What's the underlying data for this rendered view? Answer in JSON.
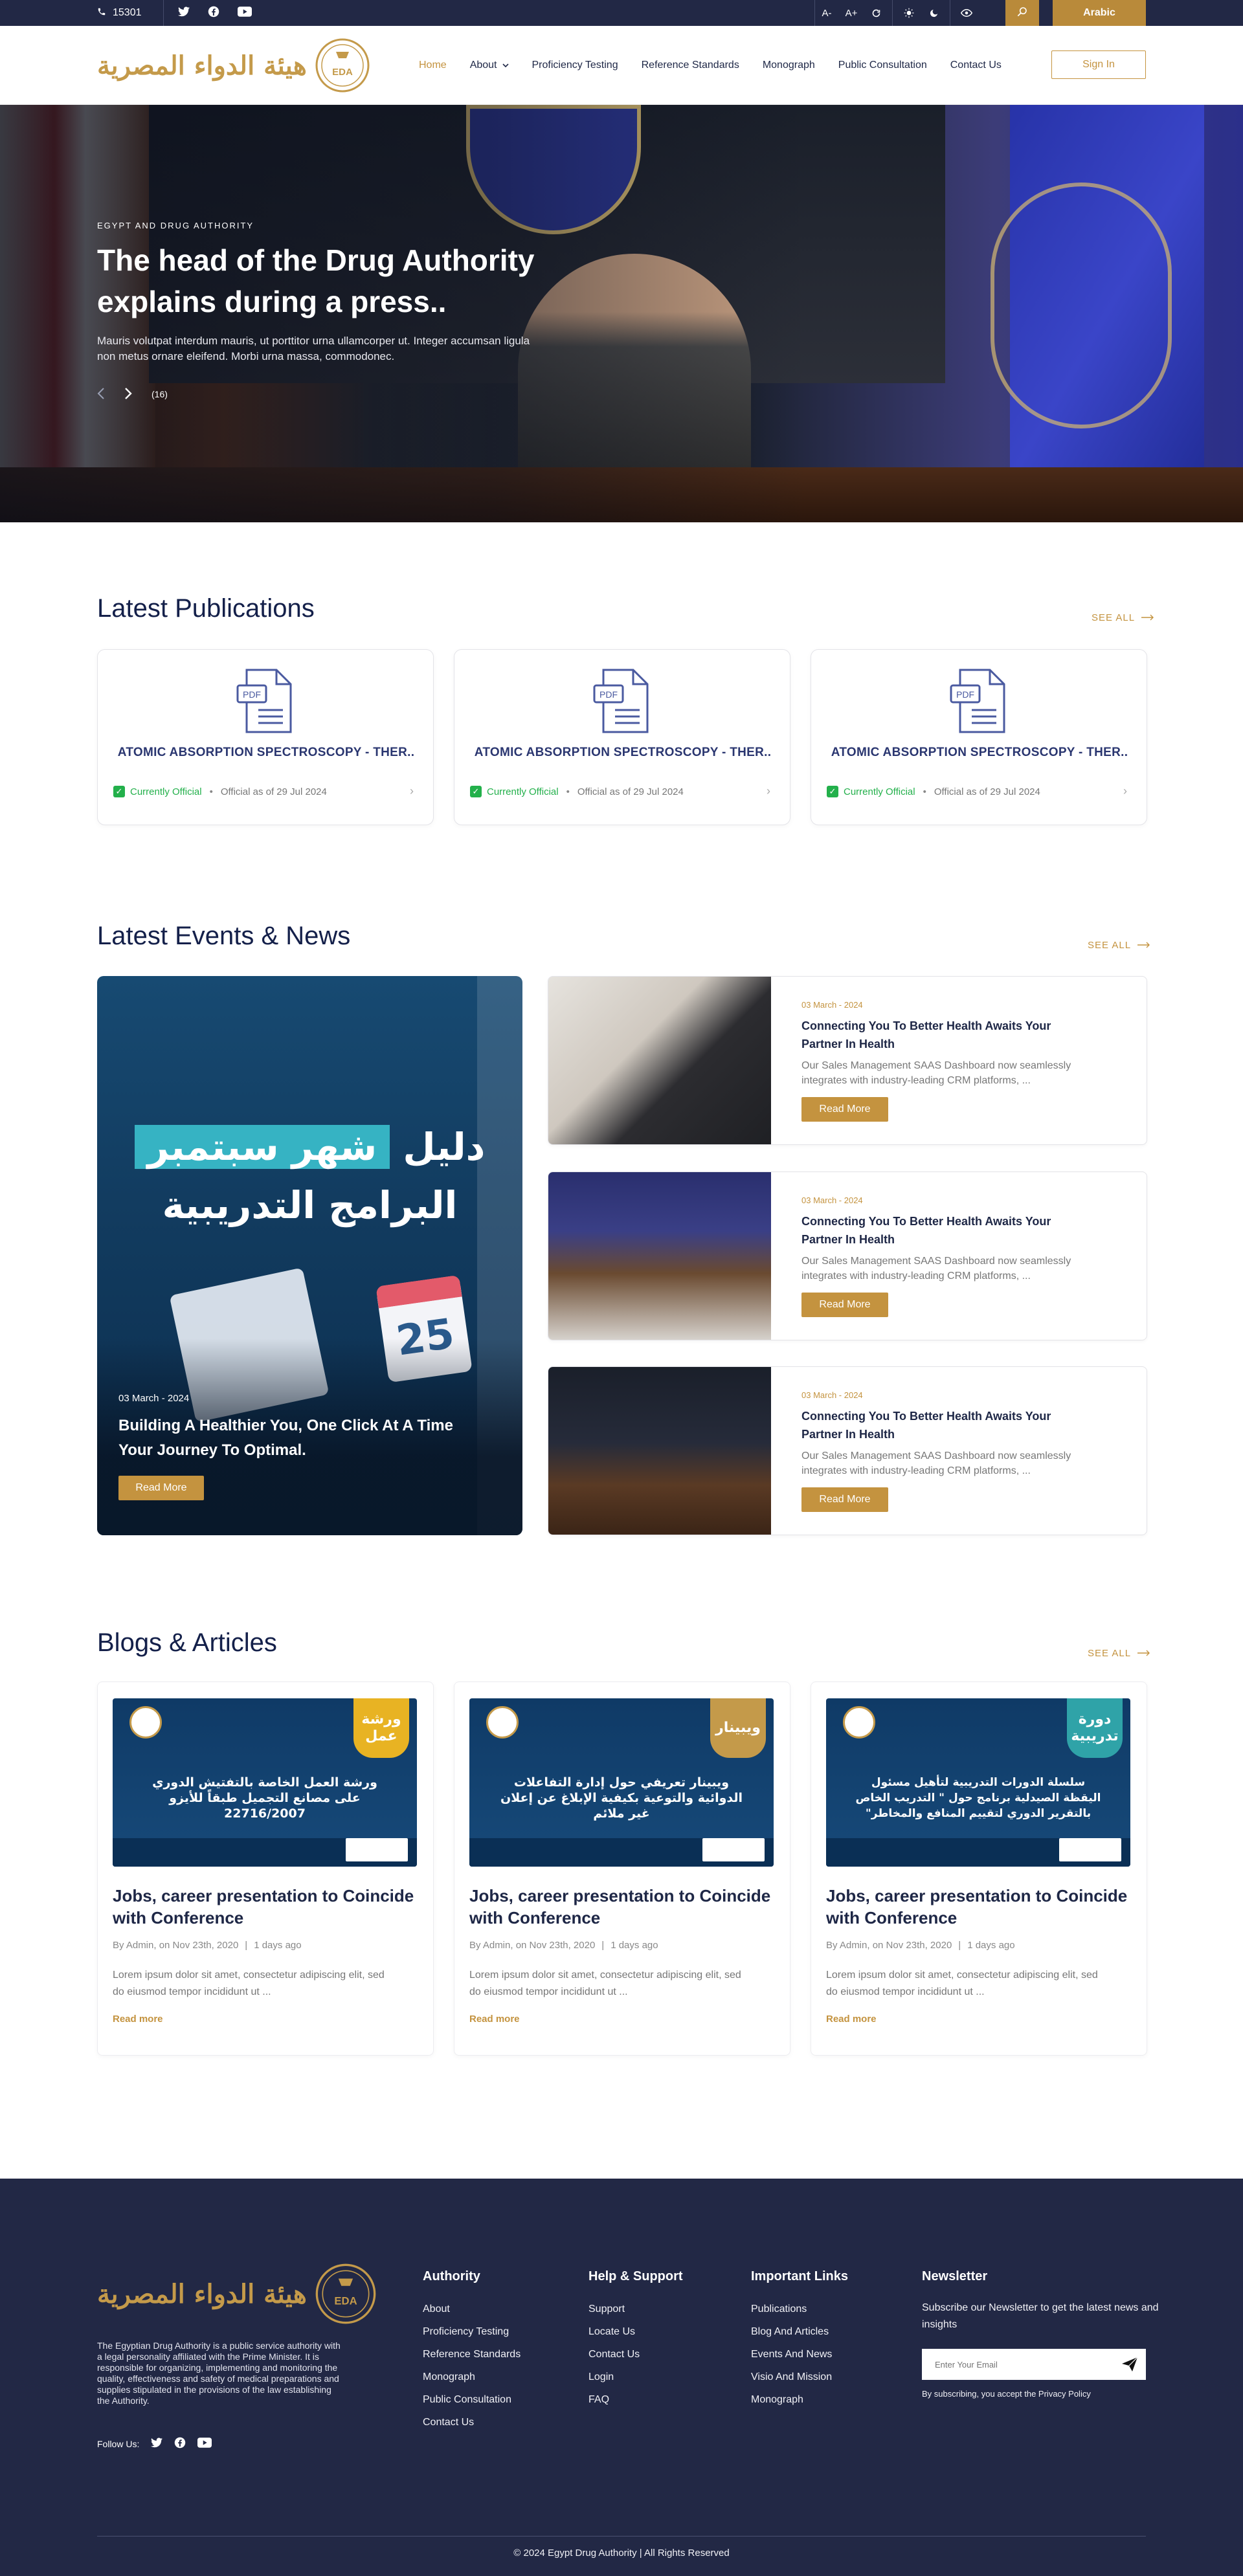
{
  "topbar": {
    "phone": "15301",
    "tools": [
      "A-",
      "A+"
    ],
    "language": "Arabic"
  },
  "header": {
    "logo_text_ar": "هيئة الدواء المصرية",
    "logo_emblem": "EDA",
    "nav": [
      "Home",
      "About",
      "Proficiency Testing",
      "Reference Standards",
      "Monograph",
      "Public Consultation",
      "Contact Us"
    ],
    "signin": "Sign In"
  },
  "hero": {
    "kicker": "EGYPT AND DRUG AUTHORITY",
    "title": "The head of the Drug Authority explains during a press..",
    "description": "Mauris volutpat interdum mauris, ut porttitor urna ullamcorper ut. Integer accumsan ligula non metus ornare eleifend. Morbi urna massa, commodonec.",
    "counter": "(16)"
  },
  "publications": {
    "title": "Latest Publications",
    "see_all": "SEE ALL",
    "items": [
      {
        "icon_label": "PDF",
        "title": "ATOMIC ABSORPTION SPECTROSCOPY - THER..",
        "status": "Currently Official",
        "date": "Official as of 29 Jul 2024"
      },
      {
        "icon_label": "PDF",
        "title": "ATOMIC ABSORPTION SPECTROSCOPY - THER..",
        "status": "Currently Official",
        "date": "Official as of 29 Jul 2024"
      },
      {
        "icon_label": "PDF",
        "title": "ATOMIC ABSORPTION SPECTROSCOPY - THER..",
        "status": "Currently Official",
        "date": "Official as of 29 Jul 2024"
      }
    ]
  },
  "events": {
    "title": "Latest Events & News",
    "see_all": "SEE ALL",
    "featured": {
      "image_text_line1_plain": "دليل",
      "image_text_line1_highlight": "شهر سبتمبر",
      "image_text_line2": "البرامج التدريبية",
      "calendar_number": "25",
      "date": "03 March - 2024",
      "title": "Building A Healthier You, One Click At A Time Your Journey To Optimal.",
      "button": "Read More"
    },
    "items": [
      {
        "date": "03 March - 2024",
        "title": "Connecting You To Better Health Awaits Your Partner In Health",
        "description": "Our Sales Management SAAS Dashboard now seamlessly integrates with industry-leading CRM platforms, ...",
        "button": "Read More"
      },
      {
        "date": "03 March - 2024",
        "title": "Connecting You To Better Health Awaits Your Partner In Health",
        "description": "Our Sales Management SAAS Dashboard now seamlessly integrates with industry-leading CRM platforms, ...",
        "button": "Read More"
      },
      {
        "date": "03 March - 2024",
        "title": "Connecting You To Better Health Awaits Your Partner In Health",
        "description": "Our Sales Management SAAS Dashboard now seamlessly integrates with industry-leading CRM platforms, ...",
        "button": "Read More"
      }
    ]
  },
  "blogs": {
    "title": "Blogs & Articles",
    "see_all": "SEE ALL",
    "items": [
      {
        "badge": "ورشة عمل",
        "badge_color": "#e8b323",
        "image_text": "ورشة العمل الخاصة بالتفتيش الدوري على مصانع التجميل طبقاً للأيزو 22716/2007",
        "title": "Jobs, career presentation to Coincide with Conference",
        "author": "By Admin, on Nov 23th, 2020",
        "ago": "1 days ago",
        "description": "Lorem ipsum dolor sit amet, consectetur adipiscing elit, sed do eiusmod tempor incididunt ut ...",
        "read_more": "Read more"
      },
      {
        "badge": "ويبينار",
        "badge_color": "#c49a4a",
        "image_text": "ويبينار تعريفي حول إدارة التفاعلات الدوائية والتوعية بكيفية الإبلاغ عن إعلان غير ملائم",
        "title": "Jobs, career presentation to Coincide with Conference",
        "author": "By Admin, on Nov 23th, 2020",
        "ago": "1 days ago",
        "description": "Lorem ipsum dolor sit amet, consectetur adipiscing elit, sed do eiusmod tempor incididunt ut ...",
        "read_more": "Read more"
      },
      {
        "badge": "دورة تدريبية",
        "badge_color": "#2fa3a8",
        "image_text": "سلسلة الدورات التدريبية لتأهيل مسئول اليقظة الصيدلية برنامج حول \" التدريب الخاص بالتقرير الدوري لتقييم المنافع والمخاطر\"",
        "title": "Jobs, career presentation to Coincide with Conference",
        "author": "By Admin, on Nov 23th, 2020",
        "ago": "1 days ago",
        "description": "Lorem ipsum dolor sit amet, consectetur adipiscing elit, sed do eiusmod tempor incididunt ut ...",
        "read_more": "Read more"
      }
    ]
  },
  "footer": {
    "about": "The Egyptian Drug Authority is a public service authority with a legal personality affiliated with the Prime Minister. It is responsible for organizing, implementing and monitoring the quality, effectiveness and safety of medical preparations and supplies stipulated in the provisions of the law establishing the Authority.",
    "follow_label": "Follow Us:",
    "columns": [
      {
        "title": "Authority",
        "links": [
          "About",
          "Proficiency Testing",
          "Reference Standards",
          "Monograph",
          "Public Consultation",
          "Contact Us"
        ]
      },
      {
        "title": "Help & Support",
        "links": [
          "Support",
          "Locate Us",
          "Contact Us",
          "Login",
          "FAQ"
        ]
      },
      {
        "title": "Important Links",
        "links": [
          "Publications",
          "Blog And Articles",
          "Events And News",
          "Visio And Mission",
          "Monograph"
        ]
      }
    ],
    "newsletter": {
      "title": "Newsletter",
      "text": "Subscribe our Newsletter to get the latest news and insights",
      "placeholder": "Enter Your Email",
      "note": "By subscribing, you accept the Privacy Policy"
    },
    "copyright": "© 2024 Egypt Drug Authority | All Rights Reserved"
  },
  "colors": {
    "navy": "#222845",
    "gold": "#c4933f",
    "green": "#23b04b",
    "title": "#14204a"
  }
}
